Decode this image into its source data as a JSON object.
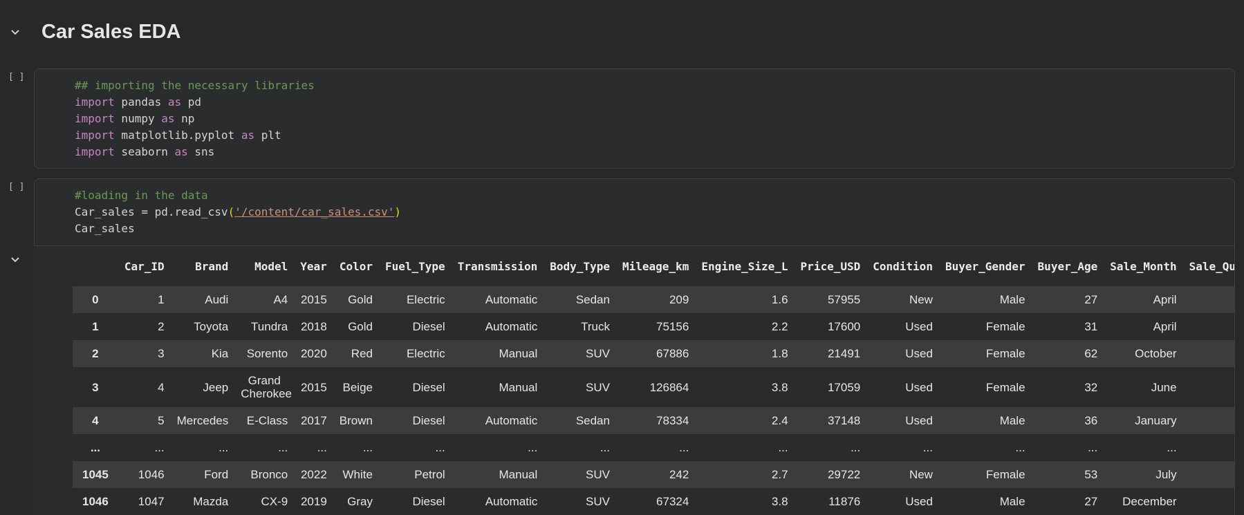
{
  "section": {
    "title": "Car Sales EDA"
  },
  "cell1": {
    "exec": "[ ]",
    "code": [
      [
        [
          "c",
          "## importing the necessary libraries"
        ]
      ],
      [
        [
          "k",
          "import"
        ],
        [
          "t",
          " pandas "
        ],
        [
          "k",
          "as"
        ],
        [
          "t",
          " pd"
        ]
      ],
      [
        [
          "k",
          "import"
        ],
        [
          "t",
          " numpy "
        ],
        [
          "k",
          "as"
        ],
        [
          "t",
          " np"
        ]
      ],
      [
        [
          "k",
          "import"
        ],
        [
          "t",
          " matplotlib.pyplot "
        ],
        [
          "k",
          "as"
        ],
        [
          "t",
          " plt"
        ]
      ],
      [
        [
          "k",
          "import"
        ],
        [
          "t",
          " seaborn "
        ],
        [
          "k",
          "as"
        ],
        [
          "t",
          " sns"
        ]
      ]
    ]
  },
  "cell2": {
    "exec": "[ ]",
    "code": [
      [
        [
          "c",
          "#loading in the data"
        ]
      ],
      [
        [
          "t",
          "Car_sales = pd.read_csv"
        ],
        [
          "p",
          "("
        ],
        [
          "s",
          "'/content/car_sales.csv'"
        ],
        [
          "p",
          ")"
        ]
      ],
      [
        [
          "t",
          "Car_sales"
        ]
      ]
    ]
  },
  "table": {
    "columns": [
      "",
      "Car_ID",
      "Brand",
      "Model",
      "Year",
      "Color",
      "Fuel_Type",
      "Transmission",
      "Body_Type",
      "Mileage_km",
      "Engine_Size_L",
      "Price_USD",
      "Condition",
      "Buyer_Gender",
      "Buyer_Age",
      "Sale_Month",
      "Sale_Qu"
    ],
    "rows": [
      [
        "0",
        "1",
        "Audi",
        "A4",
        "2015",
        "Gold",
        "Electric",
        "Automatic",
        "Sedan",
        "209",
        "1.6",
        "57955",
        "New",
        "Male",
        "27",
        "April",
        ""
      ],
      [
        "1",
        "2",
        "Toyota",
        "Tundra",
        "2018",
        "Gold",
        "Diesel",
        "Automatic",
        "Truck",
        "75156",
        "2.2",
        "17600",
        "Used",
        "Female",
        "31",
        "April",
        ""
      ],
      [
        "2",
        "3",
        "Kia",
        "Sorento",
        "2020",
        "Red",
        "Electric",
        "Manual",
        "SUV",
        "67886",
        "1.8",
        "21491",
        "Used",
        "Female",
        "62",
        "October",
        ""
      ],
      [
        "3",
        "4",
        "Jeep",
        "Grand Cherokee",
        "2015",
        "Beige",
        "Diesel",
        "Manual",
        "SUV",
        "126864",
        "3.8",
        "17059",
        "Used",
        "Female",
        "32",
        "June",
        ""
      ],
      [
        "4",
        "5",
        "Mercedes",
        "E-Class",
        "2017",
        "Brown",
        "Diesel",
        "Automatic",
        "Sedan",
        "78334",
        "2.4",
        "37148",
        "Used",
        "Male",
        "36",
        "January",
        ""
      ],
      [
        "...",
        "...",
        "...",
        "...",
        "...",
        "...",
        "...",
        "...",
        "...",
        "...",
        "...",
        "...",
        "...",
        "...",
        "...",
        "...",
        ""
      ],
      [
        "1045",
        "1046",
        "Ford",
        "Bronco",
        "2022",
        "White",
        "Petrol",
        "Manual",
        "SUV",
        "242",
        "2.7",
        "29722",
        "New",
        "Female",
        "53",
        "July",
        ""
      ],
      [
        "1046",
        "1047",
        "Mazda",
        "CX-9",
        "2019",
        "Gray",
        "Diesel",
        "Automatic",
        "SUV",
        "67324",
        "3.8",
        "11876",
        "Used",
        "Male",
        "27",
        "December",
        ""
      ]
    ]
  },
  "colors": {
    "background": "#272829",
    "cell": "#2b2c2e",
    "comment": "#6a9955",
    "keyword": "#c586c0",
    "string": "#ce9178"
  }
}
